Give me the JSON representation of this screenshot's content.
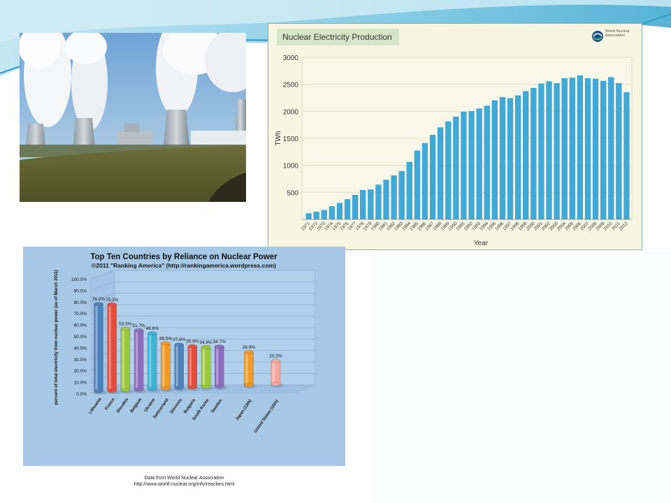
{
  "slide": {
    "accent_color": "#5bb8d6"
  },
  "photo": {
    "subject": "nuclear-power-plant-cooling-towers"
  },
  "chart_data": [
    {
      "type": "bar",
      "title": "Nuclear Electricity Production",
      "logo_text": "World Nuclear Association",
      "xlabel": "Year",
      "ylabel": "TWh",
      "ylim": [
        0,
        3000
      ],
      "yticks": [
        500,
        1000,
        1500,
        2000,
        2500,
        3000
      ],
      "grid": true,
      "bar_color": "#3fa9d8",
      "categories": [
        "1971",
        "1972",
        "1973",
        "1974",
        "1975",
        "1976",
        "1977",
        "1978",
        "1979",
        "1980",
        "1981",
        "1982",
        "1983",
        "1984",
        "1985",
        "1986",
        "1987",
        "1988",
        "1989",
        "1990",
        "1991",
        "1992",
        "1993",
        "1994",
        "1995",
        "1996",
        "1997",
        "1998",
        "1999",
        "2000",
        "2001",
        "2002",
        "2003",
        "2004",
        "2005",
        "2006",
        "2007",
        "2008",
        "2009",
        "2010",
        "2011",
        "2012"
      ],
      "values": [
        110,
        140,
        170,
        240,
        300,
        370,
        450,
        540,
        550,
        640,
        730,
        810,
        890,
        1060,
        1270,
        1410,
        1560,
        1700,
        1810,
        1900,
        1990,
        2000,
        2050,
        2100,
        2200,
        2260,
        2240,
        2290,
        2370,
        2430,
        2510,
        2550,
        2520,
        2610,
        2620,
        2660,
        2610,
        2600,
        2560,
        2630,
        2520,
        2350
      ]
    },
    {
      "type": "bar",
      "title": "Top Ten Countries by Reliance on Nuclear Power",
      "subtitle": "©2011 \"Ranking America\" (http://rankingamerica.wordpress.com)",
      "ylabel": "percent of total electricity from nuclear power (as of March 2011)",
      "ylim": [
        0,
        100
      ],
      "ytick_labels": [
        "0.0%",
        "10.0%",
        "20.0%",
        "30.0%",
        "40.0%",
        "50.0%",
        "60.0%",
        "70.0%",
        "80.0%",
        "90.0%",
        "100.0%"
      ],
      "grid": true,
      "categories": [
        "Lithuania",
        "France",
        "Slovakia",
        "Belgium",
        "Ukraine",
        "Switzerland",
        "Slovenia",
        "Bulgaria",
        "South Korea",
        "Sweden",
        "Japan (13th)",
        "United States (16th)"
      ],
      "values": [
        76.2,
        75.2,
        53.5,
        51.7,
        48.6,
        39.5,
        37.9,
        35.9,
        34.8,
        34.7,
        28.9,
        20.2
      ],
      "data_labels": [
        "76.2%",
        "75.2%",
        "53.5%",
        "51.7%",
        "48.6%",
        "39.5%",
        "37.9%",
        "35.9%",
        "34.8%",
        "34.7%",
        "28.9%",
        "20.2%"
      ],
      "colors": [
        "#4f81bd",
        "#e84c3d",
        "#9bcb3c",
        "#8b6cc0",
        "#3cb4d6",
        "#f39a25",
        "#4f81bd",
        "#e84c3d",
        "#9bcb3c",
        "#8b6cc0",
        "#f39a25",
        "#f7a8a0"
      ]
    }
  ],
  "source_note": {
    "line1": "Data from World Nuclear Association",
    "line2": "http://www.world-nuclear.org/info/reactors.html"
  }
}
